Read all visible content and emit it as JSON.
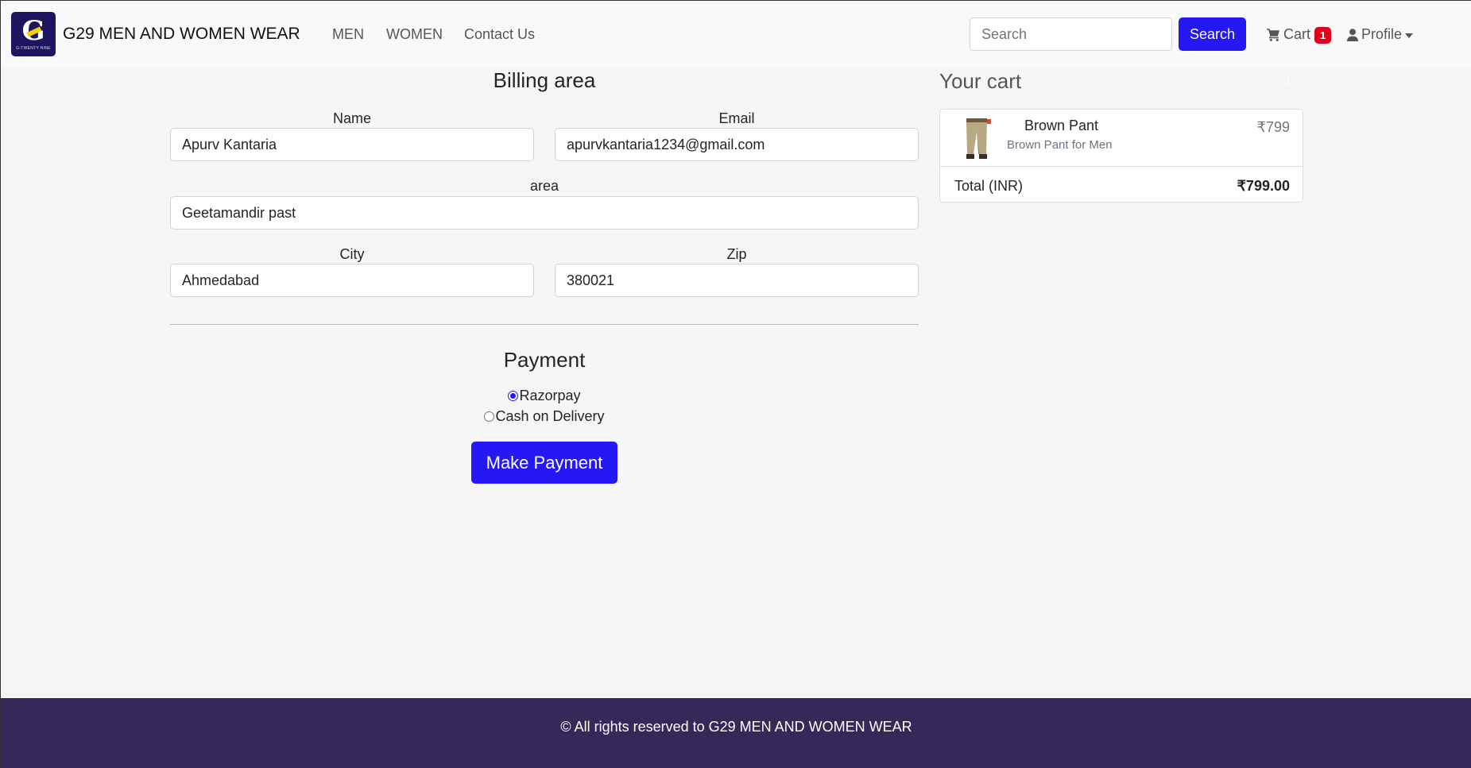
{
  "brand": {
    "logo_text": "G",
    "logo_sub": "G-TWENTY NINE",
    "name": "G29 MEN AND WOMEN WEAR"
  },
  "nav": {
    "links": [
      "MEN",
      "WOMEN",
      "Contact Us"
    ]
  },
  "search": {
    "placeholder": "Search",
    "value": "",
    "button_label": "Search"
  },
  "cart_link": {
    "label": "Cart",
    "count": "1"
  },
  "profile_link": {
    "label": "Profile"
  },
  "billing": {
    "title": "Billing area",
    "name_label": "Name",
    "name_value": "Apurv Kantaria",
    "email_label": "Email",
    "email_value": "apurvkantaria1234@gmail.com",
    "area_label": "area",
    "area_value": "Geetamandir past",
    "city_label": "City",
    "city_value": "Ahmedabad",
    "zip_label": "Zip",
    "zip_value": "380021"
  },
  "payment": {
    "title": "Payment",
    "options": [
      {
        "label": "Razorpay",
        "selected": true
      },
      {
        "label": "Cash on Delivery",
        "selected": false
      }
    ],
    "button_label": "Make Payment"
  },
  "cart": {
    "title": "Your cart",
    "count": "1",
    "items": [
      {
        "name": "Brown Pant",
        "description": "Brown Pant for Men",
        "price": "₹799"
      }
    ],
    "total_label": "Total (INR)",
    "total_value": "₹799.00"
  },
  "footer": {
    "text": "© All rights reserved to G29 MEN AND WOMEN WEAR"
  },
  "colors": {
    "primary": "#2518f5",
    "badge": "#e3001b",
    "footer_bg": "#37285a",
    "logo_bg": "#1d1560"
  }
}
